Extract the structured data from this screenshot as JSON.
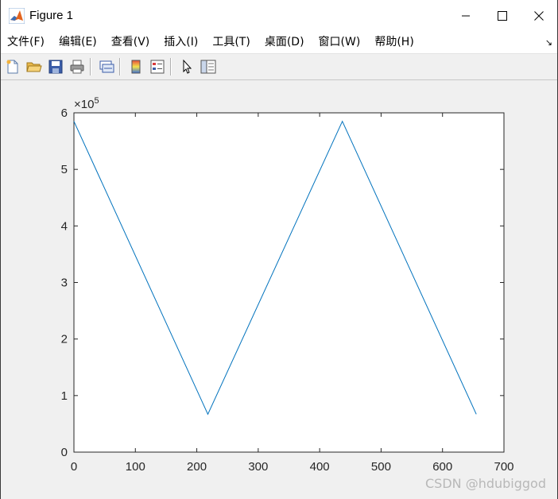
{
  "window": {
    "title": "Figure 1",
    "controls": {
      "minimize": "minimize-icon",
      "maximize": "maximize-icon",
      "close": "close-icon"
    }
  },
  "menu": {
    "items": [
      "文件(F)",
      "编辑(E)",
      "查看(V)",
      "插入(I)",
      "工具(T)",
      "桌面(D)",
      "窗口(W)",
      "帮助(H)"
    ],
    "corner": "↘"
  },
  "toolbar": {
    "buttons": [
      "new-figure-icon",
      "open-file-icon",
      "save-icon",
      "print-icon",
      "link-plot-icon",
      "colorbar-icon",
      "legend-icon",
      "pointer-icon",
      "property-editor-icon"
    ]
  },
  "watermark": "CSDN @hdubiggod",
  "colors": {
    "line": "#0072bd",
    "axes_bg": "#ffffff",
    "figure_bg": "#f0f0f0"
  },
  "chart_data": {
    "type": "line",
    "title": "",
    "xlabel": "",
    "ylabel": "",
    "xlim": [
      0,
      700
    ],
    "ylim": [
      0,
      600000
    ],
    "x_ticks": [
      0,
      100,
      200,
      300,
      400,
      500,
      600,
      700
    ],
    "y_ticks": [
      0,
      100000,
      200000,
      300000,
      400000,
      500000,
      600000
    ],
    "y_tick_labels": [
      "0",
      "1",
      "2",
      "3",
      "4",
      "5",
      "6"
    ],
    "y_exponent": "×10",
    "y_exponent_power": "5",
    "grid": false,
    "series": [
      {
        "x": [
          0,
          218,
          437,
          655
        ],
        "y": [
          585000,
          67000,
          585000,
          67000
        ]
      }
    ]
  }
}
